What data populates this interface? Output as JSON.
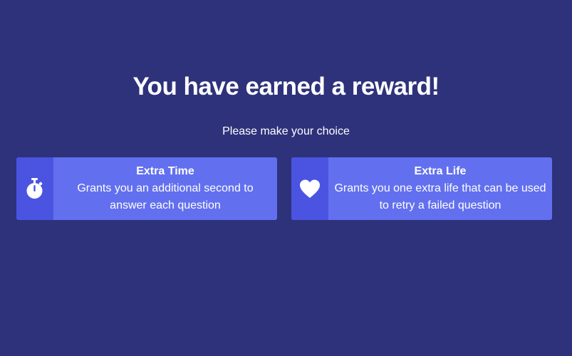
{
  "heading": "You have earned a reward!",
  "subheading": "Please make your choice",
  "colors": {
    "background": "#2e327b",
    "card": "#6270ef",
    "card_icon_panel": "#4a54e1",
    "text": "#ffffff"
  },
  "rewards": [
    {
      "icon": "stopwatch-icon",
      "title": "Extra Time",
      "description": "Grants you an additional second to answer each question"
    },
    {
      "icon": "heart-icon",
      "title": "Extra Life",
      "description": "Grants you one extra life that can be used to retry a failed question"
    }
  ]
}
